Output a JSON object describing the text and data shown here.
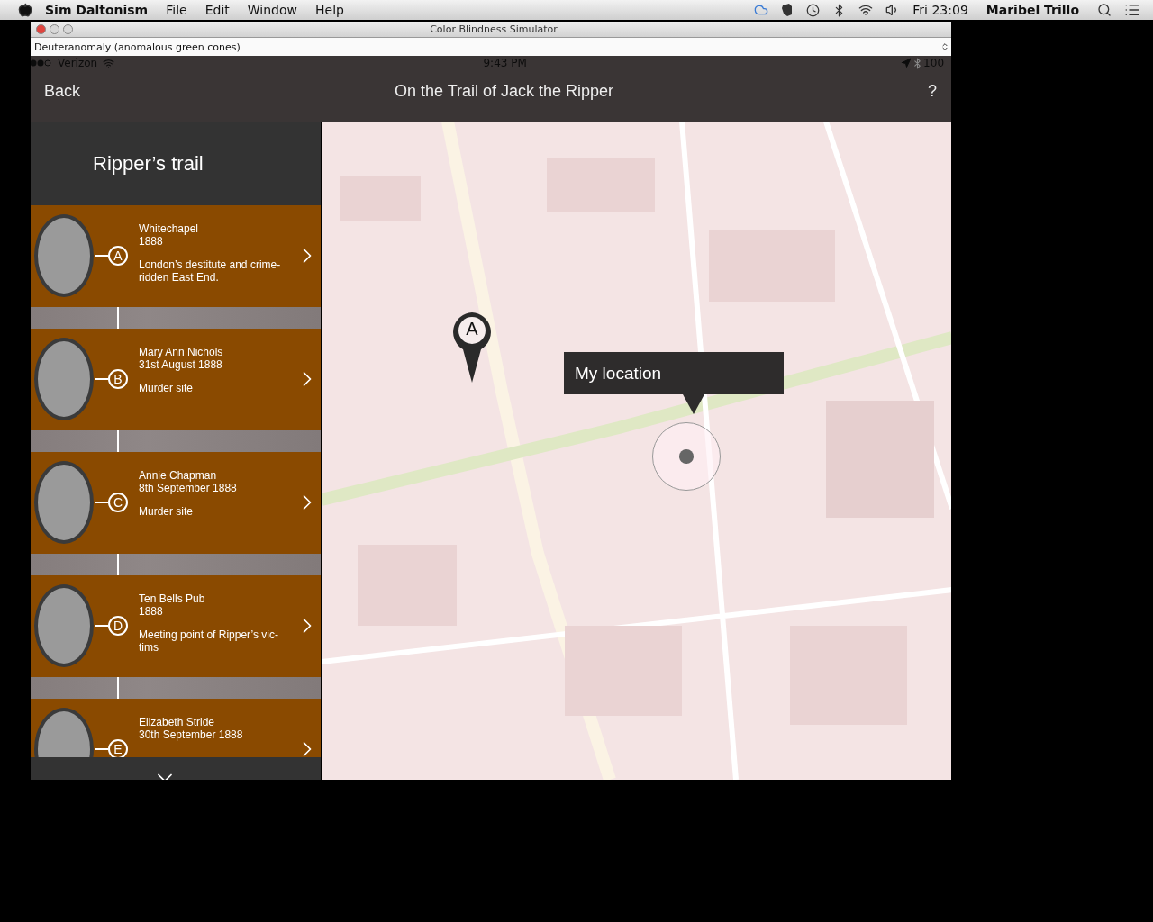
{
  "menubar": {
    "app": "Sim Daltonism",
    "menus": [
      "File",
      "Edit",
      "Window",
      "Help"
    ],
    "clock": "Fri 23:09",
    "user": "Maribel Trillo"
  },
  "window": {
    "title": "Color Blindness Simulator",
    "mode": "Deuteranomaly (anomalous green cones)"
  },
  "status_bar": {
    "carrier": "Verizon",
    "time": "9:43 PM",
    "battery": "100"
  },
  "nav": {
    "back": "Back",
    "title": "On the Trail of Jack the Ripper",
    "help": "?"
  },
  "sidebar": {
    "title": "Ripper’s trail",
    "items": [
      {
        "marker": "A",
        "title": "Whitechapel",
        "date": "1888",
        "description": "London’s destitute and crime-ridden East End."
      },
      {
        "marker": "B",
        "title": "Mary Ann Nichols",
        "date": "31st August 1888",
        "description": "Murder site"
      },
      {
        "marker": "C",
        "title": "Annie Chapman",
        "date": "8th September 1888",
        "description": "Murder site"
      },
      {
        "marker": "D",
        "title": "Ten Bells Pub",
        "date": "1888",
        "description": "Meeting point of Ripper’s vic-tims"
      },
      {
        "marker": "E",
        "title": "Elizabeth Stride",
        "date": "30th September 1888"
      }
    ]
  },
  "map": {
    "pin": "A",
    "callout": "My location"
  }
}
